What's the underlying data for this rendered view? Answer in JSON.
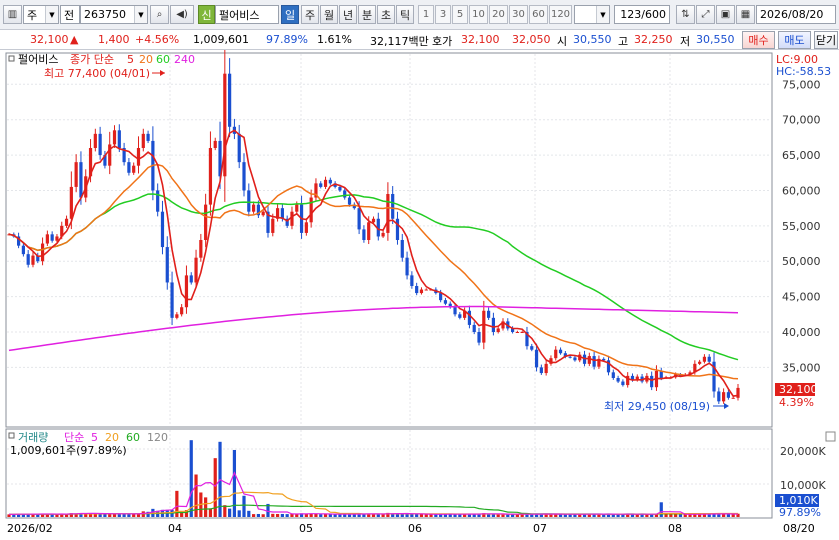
{
  "toolbar": {
    "market": "주",
    "period_type": "전",
    "code": "263750",
    "lock_char": "신",
    "name": "펄어비스",
    "periods": [
      "일",
      "주",
      "월",
      "년",
      "분",
      "초",
      "틱"
    ],
    "selected_period": "일",
    "intervals": [
      "1",
      "3",
      "5",
      "10",
      "20",
      "30",
      "60",
      "120"
    ],
    "count": "123",
    "total": "/600",
    "date": "2026/08/20"
  },
  "quote": {
    "price": "32,100",
    "arrow": "▲",
    "change": "1,400",
    "change_pct": "+4.56%",
    "volume": "1,009,601",
    "vol_ratio": "97.89%",
    "turnover": "1.61%",
    "amount": "32,117백만",
    "hoga_label": "호가",
    "ask": "32,100",
    "bid": "32,050",
    "open_label": "시",
    "open": "30,550",
    "high_label": "고",
    "high": "32,250",
    "low_label": "저",
    "low": "30,550",
    "buy_label": "매수",
    "sell_label": "매도",
    "close_label": "닫기"
  },
  "price_panel": {
    "legend_name": "펄어비스",
    "legend_ma": "종가 단순",
    "ma_periods": [
      "5",
      "20",
      "60",
      "240"
    ],
    "ma_colors": [
      "#e0201b",
      "#f07318",
      "#22cc22",
      "#e020e0"
    ],
    "lc": "LC:9.00",
    "hc": "HC:-58.53",
    "high_marker": "최고 77,400 (04/01)",
    "low_marker": "최저 29,450 (08/19)",
    "current_price": "32,100",
    "current_pct": "4.39%",
    "y_ticks": [
      "75,000",
      "70,000",
      "65,000",
      "60,000",
      "55,000",
      "50,000",
      "45,000",
      "40,000",
      "35,000"
    ]
  },
  "volume_panel": {
    "legend_name": "거래량",
    "legend_ma": "단순",
    "ma_periods": [
      "5",
      "20",
      "60",
      "120"
    ],
    "ma_colors": [
      "#e020e0",
      "#f0a020",
      "#22aa22",
      "#888888"
    ],
    "volume_text": "1,009,601주(97.89%)",
    "y_ticks": [
      "20,000K",
      "10,000K"
    ],
    "current_volume": "1,010K",
    "current_pct": "97.89%"
  },
  "x_axis": {
    "labels": [
      "2026/02",
      "04",
      "05",
      "06",
      "07",
      "08"
    ],
    "right_label": "08/20"
  },
  "chart_data": {
    "type": "candlestick",
    "ylim": [
      27000,
      79000
    ],
    "closes": [
      53800,
      53500,
      52200,
      51000,
      49500,
      50800,
      50000,
      52500,
      53800,
      52900,
      53500,
      55000,
      56000,
      60500,
      64000,
      59000,
      62000,
      66000,
      68000,
      65000,
      63500,
      66500,
      68500,
      66000,
      64000,
      62500,
      63500,
      66000,
      68000,
      67000,
      60000,
      57000,
      52000,
      47000,
      42000,
      42500,
      43500,
      48000,
      47000,
      50500,
      53000,
      58000,
      66000,
      67000,
      62000,
      76500,
      69000,
      68000,
      64000,
      60000,
      57000,
      58000,
      56500,
      57000,
      54000,
      56000,
      57500,
      56000,
      55000,
      57000,
      58000,
      54000,
      55500,
      59000,
      61000,
      60500,
      61500,
      61000,
      60500,
      60000,
      59000,
      58000,
      57500,
      54500,
      53000,
      55500,
      56000,
      53500,
      54000,
      59500,
      56000,
      53000,
      50500,
      48000,
      46500,
      45500,
      46000,
      46000,
      46000,
      45500,
      44500,
      44000,
      43500,
      42500,
      42000,
      43000,
      41000,
      40000,
      38500,
      43000,
      42000,
      40000,
      40500,
      41500,
      40500,
      40000,
      40000,
      40000,
      38000,
      37500,
      35000,
      34200,
      35500,
      36300,
      37500,
      37000,
      36500,
      36400,
      36000,
      36800,
      35500,
      36600,
      35100,
      36200,
      36000,
      34300,
      33500,
      33000,
      32500,
      33800,
      33200,
      33700,
      33000,
      33800,
      32200,
      34500,
      33500,
      33600,
      33600,
      34000,
      33900,
      34000,
      34300,
      35500,
      35800,
      36500,
      35800,
      31600,
      30200,
      31500,
      30700,
      30700,
      32100
    ]
  }
}
